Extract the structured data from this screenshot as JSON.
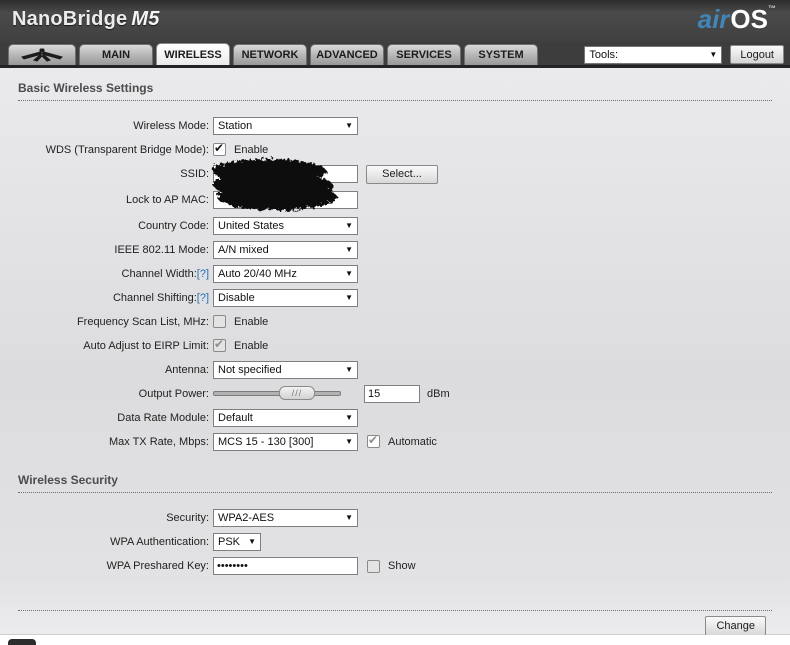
{
  "header": {
    "brand": "NanoBridge",
    "model": "M5",
    "logo_air": "air",
    "logo_os": "OS",
    "logo_tm": "™"
  },
  "nav": {
    "tabs": [
      "MAIN",
      "WIRELESS",
      "NETWORK",
      "ADVANCED",
      "SERVICES",
      "SYSTEM"
    ],
    "active_tab": "WIRELESS",
    "tools": "Tools:",
    "logout": "Logout"
  },
  "icons": {
    "dropdown_arrow": "▼",
    "check": "✔",
    "slider_grip": "///",
    "antenna": "ubiquiti-antenna"
  },
  "colors": {
    "accent_blue": "#4286b8",
    "help_link_blue": "#2a6db4",
    "header_dark": "#3d3d3d"
  },
  "basic": {
    "heading": "Basic Wireless Settings",
    "wireless_mode": {
      "label": "Wireless Mode:",
      "value": "Station"
    },
    "wds": {
      "label": "WDS (Transparent Bridge Mode):",
      "checkbox_label": "Enable",
      "checked": true
    },
    "ssid": {
      "label": "SSID:",
      "value": "",
      "redacted": true,
      "button": "Select..."
    },
    "lock_ap_mac": {
      "label": "Lock to AP MAC:",
      "value": "",
      "redacted": true
    },
    "country_code": {
      "label": "Country Code:",
      "value": "United States"
    },
    "ieee_mode": {
      "label": "IEEE 802.11 Mode:",
      "value": "A/N mixed"
    },
    "channel_width": {
      "label": "Channel Width:",
      "help": "[?]",
      "value": "Auto 20/40 MHz"
    },
    "channel_shifting": {
      "label": "Channel Shifting:",
      "help": "[?]",
      "value": "Disable"
    },
    "freq_scan": {
      "label": "Frequency Scan List, MHz:",
      "checkbox_label": "Enable",
      "checked": false
    },
    "eirp": {
      "label": "Auto Adjust to EIRP Limit:",
      "checkbox_label": "Enable",
      "checked": true,
      "disabled": true
    },
    "antenna": {
      "label": "Antenna:",
      "value": "Not specified"
    },
    "output_power": {
      "label": "Output Power:",
      "value": "15",
      "unit": "dBm"
    },
    "data_rate": {
      "label": "Data Rate Module:",
      "value": "Default"
    },
    "max_tx": {
      "label": "Max TX Rate, Mbps:",
      "value": "MCS 15 - 130 [300]",
      "checkbox_label": "Automatic",
      "checked": true,
      "disabled": true
    }
  },
  "security_section": {
    "heading": "Wireless Security",
    "security": {
      "label": "Security:",
      "value": "WPA2-AES"
    },
    "wpa_auth": {
      "label": "WPA Authentication:",
      "value": "PSK"
    },
    "wpa_key": {
      "label": "WPA Preshared Key:",
      "value": "••••••••",
      "checkbox_label": "Show",
      "checked": false
    }
  },
  "footer": {
    "change": "Change"
  }
}
